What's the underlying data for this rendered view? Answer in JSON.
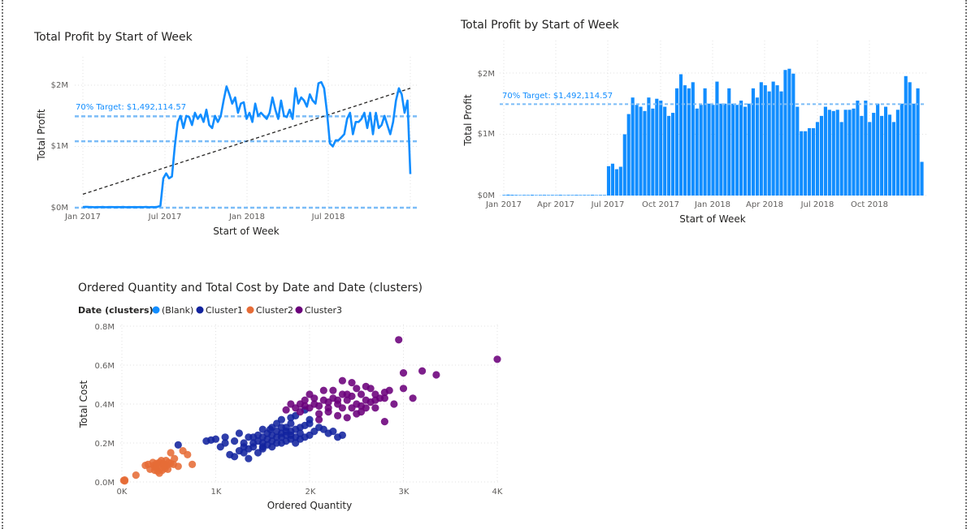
{
  "charts": {
    "line": {
      "title": "Total Profit by Start of Week",
      "xlabel": "Start of Week",
      "ylabel": "Total Profit",
      "y_ticks": [
        "$0M",
        "$1M",
        "$2M"
      ],
      "x_ticks": [
        "Jan 2017",
        "Jul 2017",
        "Jan 2018",
        "Jul 2018"
      ],
      "reference_label": "70% Target: $1,492,114.57"
    },
    "bar": {
      "title": "Total Profit by Start of Week",
      "xlabel": "Start of Week",
      "ylabel": "Total Profit",
      "y_ticks": [
        "$0M",
        "$1M",
        "$2M"
      ],
      "x_ticks": [
        "Jan 2017",
        "Apr 2017",
        "Jul 2017",
        "Oct 2017",
        "Jan 2018",
        "Apr 2018",
        "Jul 2018",
        "Oct 2018"
      ],
      "reference_label": "70% Target: $1,492,114.57"
    },
    "scatter": {
      "title": "Ordered Quantity and Total Cost by Date and Date (clusters)",
      "xlabel": "Ordered Quantity",
      "ylabel": "Total Cost",
      "x_ticks": [
        "0K",
        "1K",
        "2K",
        "3K",
        "4K"
      ],
      "y_ticks": [
        "0.0M",
        "0.2M",
        "0.4M",
        "0.6M",
        "0.8M"
      ],
      "legend_title": "Date (clusters)",
      "legend": [
        {
          "label": "(Blank)",
          "color": "#118dff"
        },
        {
          "label": "Cluster1",
          "color": "#12239e"
        },
        {
          "label": "Cluster2",
          "color": "#e66c37"
        },
        {
          "label": "Cluster3",
          "color": "#6b007b"
        }
      ]
    }
  },
  "chart_data": [
    {
      "type": "line",
      "title": "Total Profit by Start of Week",
      "xlabel": "Start of Week",
      "ylabel": "Total Profit",
      "x_start": "2017-01-02",
      "x_interval_days": 7,
      "ylim": [
        0,
        2000000
      ],
      "series": [
        {
          "name": "Total Profit",
          "color": "#118dff",
          "values": [
            10000,
            15000,
            12000,
            10000,
            8000,
            10000,
            9000,
            12000,
            8000,
            10000,
            11000,
            9000,
            10000,
            9000,
            12000,
            8000,
            10000,
            9000,
            11000,
            9000,
            10000,
            9000,
            12000,
            8000,
            10000,
            9000,
            15000,
            30000,
            480000,
            560000,
            480000,
            510000,
            1000000,
            1400000,
            1500000,
            1300000,
            1500000,
            1480000,
            1350000,
            1550000,
            1450000,
            1520000,
            1400000,
            1600000,
            1350000,
            1300000,
            1500000,
            1400000,
            1500000,
            1750000,
            1980000,
            1850000,
            1700000,
            1800000,
            1550000,
            1700000,
            1720000,
            1450000,
            1550000,
            1400000,
            1700000,
            1500000,
            1550000,
            1500000,
            1450000,
            1550000,
            1800000,
            1600000,
            1450000,
            1750000,
            1500000,
            1480000,
            1600000,
            1450000,
            1950000,
            1700000,
            1800000,
            1750000,
            1650000,
            1850000,
            1750000,
            1700000,
            2030000,
            2050000,
            1950000,
            1550000,
            1050000,
            1000000,
            1100000,
            1100000,
            1150000,
            1200000,
            1450000,
            1550000,
            1200000,
            1400000,
            1400000,
            1450000,
            1550000,
            1300000,
            1550000,
            1200000,
            1550000,
            1300000,
            1350000,
            1500000,
            1350000,
            1200000,
            1400000,
            1750000,
            1950000,
            1850000,
            1550000,
            1750000,
            550000
          ]
        }
      ],
      "trend_line": {
        "start": 220000,
        "end": 1950000
      },
      "reference_lines": [
        {
          "value": 1492114.57,
          "label": "70% Target: $1,492,114.57"
        },
        {
          "value": 1085000
        },
        {
          "value": 0
        }
      ]
    },
    {
      "type": "bar",
      "title": "Total Profit by Start of Week",
      "xlabel": "Start of Week",
      "ylabel": "Total Profit",
      "x_start": "2017-01-02",
      "x_interval_days": 7,
      "ylim": [
        0,
        2000000
      ],
      "series": [
        {
          "name": "Total Profit",
          "color": "#118dff",
          "values": [
            10000,
            15000,
            12000,
            10000,
            8000,
            10000,
            9000,
            12000,
            8000,
            10000,
            11000,
            9000,
            10000,
            9000,
            12000,
            8000,
            10000,
            9000,
            11000,
            9000,
            10000,
            9000,
            12000,
            8000,
            10000,
            9000,
            480000,
            520000,
            430000,
            470000,
            1000000,
            1330000,
            1600000,
            1480000,
            1450000,
            1380000,
            1600000,
            1420000,
            1580000,
            1550000,
            1450000,
            1300000,
            1350000,
            1750000,
            1980000,
            1800000,
            1750000,
            1850000,
            1420000,
            1480000,
            1750000,
            1500000,
            1480000,
            1860000,
            1500000,
            1500000,
            1750000,
            1500000,
            1480000,
            1550000,
            1450000,
            1500000,
            1750000,
            1600000,
            1850000,
            1800000,
            1700000,
            1860000,
            1800000,
            1700000,
            2050000,
            2070000,
            1990000,
            1450000,
            1050000,
            1050000,
            1100000,
            1100000,
            1200000,
            1300000,
            1450000,
            1400000,
            1380000,
            1400000,
            1200000,
            1400000,
            1400000,
            1420000,
            1550000,
            1300000,
            1550000,
            1200000,
            1350000,
            1500000,
            1300000,
            1450000,
            1320000,
            1200000,
            1400000,
            1500000,
            1950000,
            1850000,
            1500000,
            1750000,
            550000
          ]
        }
      ],
      "reference_lines": [
        {
          "value": 1492114.57,
          "label": "70% Target: $1,492,114.57"
        }
      ]
    },
    {
      "type": "scatter",
      "title": "Ordered Quantity and Total Cost by Date and Date (clusters)",
      "xlabel": "Ordered Quantity",
      "ylabel": "Total Cost",
      "xlim": [
        0,
        4000
      ],
      "ylim": [
        0,
        800000
      ],
      "series": [
        {
          "name": "Cluster2",
          "color": "#e66c37",
          "points": [
            [
              20,
              8000
            ],
            [
              30,
              10000
            ],
            [
              150,
              35000
            ],
            [
              280,
              90000
            ],
            [
              350,
              80000
            ],
            [
              400,
              100000
            ],
            [
              420,
              110000
            ],
            [
              440,
              95000
            ],
            [
              460,
              70000
            ],
            [
              480,
              85000
            ],
            [
              500,
              100000
            ],
            [
              520,
              150000
            ],
            [
              300,
              65000
            ],
            [
              350,
              60000
            ],
            [
              380,
              55000
            ],
            [
              400,
              45000
            ],
            [
              450,
              80000
            ],
            [
              560,
              120000
            ],
            [
              650,
              160000
            ],
            [
              700,
              140000
            ],
            [
              750,
              90000
            ],
            [
              330,
              100000
            ],
            [
              250,
              85000
            ],
            [
              470,
              110000
            ],
            [
              600,
              80000
            ],
            [
              550,
              90000
            ],
            [
              410,
              70000
            ],
            [
              390,
              90000
            ],
            [
              360,
              75000
            ],
            [
              430,
              60000
            ],
            [
              490,
              65000
            ],
            [
              520,
              95000
            ],
            [
              340,
              85000
            ],
            [
              370,
              95000
            ],
            [
              450,
              90000
            ],
            [
              30,
              5000
            ]
          ]
        },
        {
          "name": "Cluster1",
          "color": "#12239e",
          "points": [
            [
              600,
              190000
            ],
            [
              900,
              210000
            ],
            [
              950,
              215000
            ],
            [
              1000,
              220000
            ],
            [
              1050,
              180000
            ],
            [
              1100,
              200000
            ],
            [
              1150,
              140000
            ],
            [
              1200,
              130000
            ],
            [
              1250,
              160000
            ],
            [
              1300,
              150000
            ],
            [
              1300,
              200000
            ],
            [
              1350,
              170000
            ],
            [
              1400,
              180000
            ],
            [
              1400,
              230000
            ],
            [
              1450,
              240000
            ],
            [
              1500,
              200000
            ],
            [
              1500,
              270000
            ],
            [
              1550,
              220000
            ],
            [
              1550,
              250000
            ],
            [
              1600,
              210000
            ],
            [
              1600,
              280000
            ],
            [
              1650,
              230000
            ],
            [
              1650,
              300000
            ],
            [
              1700,
              250000
            ],
            [
              1700,
              320000
            ],
            [
              1750,
              260000
            ],
            [
              1750,
              280000
            ],
            [
              1800,
              240000
            ],
            [
              1800,
              300000
            ],
            [
              1850,
              270000
            ],
            [
              1850,
              340000
            ],
            [
              1900,
              280000
            ],
            [
              1900,
              250000
            ],
            [
              1950,
              290000
            ],
            [
              2000,
              300000
            ],
            [
              2050,
              260000
            ],
            [
              2100,
              280000
            ],
            [
              2150,
              270000
            ],
            [
              2200,
              250000
            ],
            [
              2300,
              230000
            ],
            [
              2350,
              240000
            ],
            [
              1450,
              150000
            ],
            [
              1350,
              230000
            ],
            [
              1200,
              210000
            ],
            [
              1250,
              250000
            ],
            [
              1600,
              180000
            ],
            [
              1700,
              200000
            ],
            [
              1750,
              210000
            ],
            [
              1800,
              220000
            ],
            [
              1850,
              230000
            ],
            [
              1550,
              190000
            ],
            [
              1650,
              200000
            ],
            [
              1500,
              230000
            ],
            [
              1600,
              240000
            ],
            [
              1700,
              230000
            ],
            [
              1800,
              260000
            ],
            [
              1900,
              220000
            ],
            [
              2000,
              240000
            ],
            [
              1400,
              200000
            ],
            [
              1300,
              180000
            ],
            [
              1100,
              230000
            ],
            [
              1500,
              180000
            ],
            [
              1450,
              210000
            ],
            [
              1700,
              280000
            ],
            [
              1750,
              240000
            ],
            [
              1650,
              260000
            ],
            [
              2250,
              260000
            ],
            [
              1950,
              230000
            ],
            [
              1850,
              200000
            ],
            [
              1350,
              120000
            ],
            [
              1500,
              170000
            ],
            [
              1580,
              270000
            ],
            [
              1950,
              370000
            ],
            [
              2000,
              320000
            ],
            [
              1800,
              330000
            ]
          ]
        },
        {
          "name": "Cluster3",
          "color": "#6b007b",
          "points": [
            [
              1750,
              370000
            ],
            [
              1800,
              400000
            ],
            [
              1850,
              380000
            ],
            [
              1900,
              400000
            ],
            [
              1950,
              420000
            ],
            [
              2000,
              380000
            ],
            [
              2050,
              400000
            ],
            [
              2100,
              350000
            ],
            [
              2150,
              420000
            ],
            [
              2200,
              380000
            ],
            [
              2250,
              430000
            ],
            [
              2300,
              400000
            ],
            [
              2350,
              450000
            ],
            [
              2400,
              420000
            ],
            [
              2450,
              380000
            ],
            [
              2500,
              400000
            ],
            [
              2550,
              450000
            ],
            [
              2600,
              420000
            ],
            [
              2650,
              480000
            ],
            [
              2700,
              450000
            ],
            [
              2750,
              430000
            ],
            [
              2800,
              460000
            ],
            [
              2850,
              470000
            ],
            [
              3000,
              480000
            ],
            [
              3000,
              560000
            ],
            [
              2950,
              730000
            ],
            [
              3200,
              570000
            ],
            [
              3350,
              550000
            ],
            [
              4000,
              630000
            ],
            [
              2500,
              480000
            ],
            [
              2450,
              510000
            ],
            [
              2350,
              520000
            ],
            [
              2200,
              360000
            ],
            [
              2300,
              340000
            ],
            [
              2400,
              330000
            ],
            [
              2550,
              360000
            ],
            [
              2700,
              380000
            ],
            [
              2800,
              310000
            ],
            [
              2100,
              320000
            ],
            [
              1900,
              360000
            ],
            [
              2000,
              450000
            ],
            [
              2150,
              470000
            ],
            [
              2250,
              470000
            ],
            [
              2400,
              450000
            ],
            [
              2600,
              490000
            ],
            [
              2650,
              410000
            ],
            [
              2900,
              400000
            ],
            [
              3100,
              430000
            ],
            [
              2350,
              380000
            ],
            [
              2450,
              440000
            ],
            [
              2550,
              390000
            ],
            [
              2200,
              410000
            ],
            [
              2050,
              430000
            ],
            [
              1950,
              390000
            ],
            [
              2600,
              380000
            ],
            [
              2700,
              420000
            ],
            [
              2100,
              390000
            ],
            [
              2300,
              420000
            ],
            [
              2500,
              350000
            ],
            [
              2800,
              430000
            ]
          ]
        }
      ]
    }
  ]
}
